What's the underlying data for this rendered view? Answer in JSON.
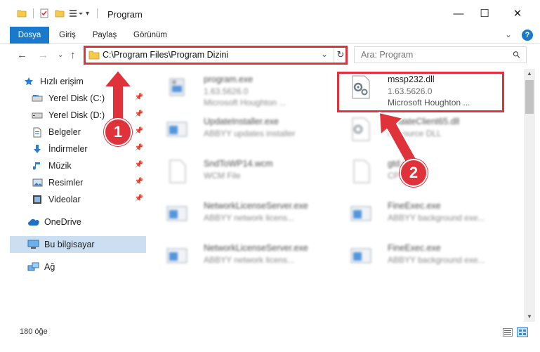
{
  "window": {
    "title": "Program",
    "minimize": "—",
    "maximize": "☐",
    "close": "✕"
  },
  "ribbon": {
    "tabs": [
      "Dosya",
      "Giriş",
      "Paylaş",
      "Görünüm"
    ],
    "expand": "⌄",
    "help": "?"
  },
  "nav": {
    "back": "←",
    "forward": "→",
    "recent": "⌄",
    "up": "↑",
    "address": "C:\\Program Files\\Program Dizini",
    "refresh": "↻",
    "dropdown": "⌄",
    "search_placeholder": "Ara: Program",
    "search_icon": "⚲"
  },
  "sidebar": {
    "items": [
      {
        "label": "Hızlı erişim",
        "icon": "star-icon"
      },
      {
        "label": "Yerel Disk (C:)",
        "icon": "drive-icon"
      },
      {
        "label": "Yerel Disk (D:)",
        "icon": "drive-icon"
      },
      {
        "label": "Belgeler",
        "icon": "documents-icon"
      },
      {
        "label": "İndirmeler",
        "icon": "download-icon"
      },
      {
        "label": "Müzik",
        "icon": "music-icon"
      },
      {
        "label": "Resimler",
        "icon": "pictures-icon"
      },
      {
        "label": "Videolar",
        "icon": "videos-icon"
      },
      {
        "label": "OneDrive",
        "icon": "cloud-icon"
      },
      {
        "label": "Bu bilgisayar",
        "icon": "computer-icon"
      },
      {
        "label": "Ağ",
        "icon": "network-icon"
      }
    ]
  },
  "files": [
    {
      "name": "program.exe",
      "line1": "1.63.5626.0",
      "line2": "Microsoft Houghton ..."
    },
    {
      "name": "mssp232.dll",
      "line1": "1.63.5626.0",
      "line2": "Microsoft Houghton ..."
    },
    {
      "name": "UpdateInstaller.exe",
      "line1": "ABBYY updates installer",
      "line2": ""
    },
    {
      "name": "UpdateClient65.dll",
      "line1": "Resource DLL",
      "line2": ""
    },
    {
      "name": "SndToWP14.wcm",
      "line1": "WCM File",
      "line2": ""
    },
    {
      "name": "gtd.cpp",
      "line1": "CPP File",
      "line2": ""
    },
    {
      "name": "NetworkLicenseServer.exe",
      "line1": "ABBYY network licens...",
      "line2": ""
    },
    {
      "name": "FineExec.exe",
      "line1": "ABBYY background exe...",
      "line2": ""
    },
    {
      "name": "NetworkLicenseServer.exe",
      "line1": "ABBYY network licens...",
      "line2": ""
    },
    {
      "name": "FineExec.exe",
      "line1": "ABBYY background exe...",
      "line2": ""
    }
  ],
  "status": {
    "count": "180 öğe"
  },
  "callouts": [
    "1",
    "2"
  ],
  "colors": {
    "accent": "#1979ca",
    "highlight": "#e0323a",
    "selected": "#ccdef2"
  }
}
